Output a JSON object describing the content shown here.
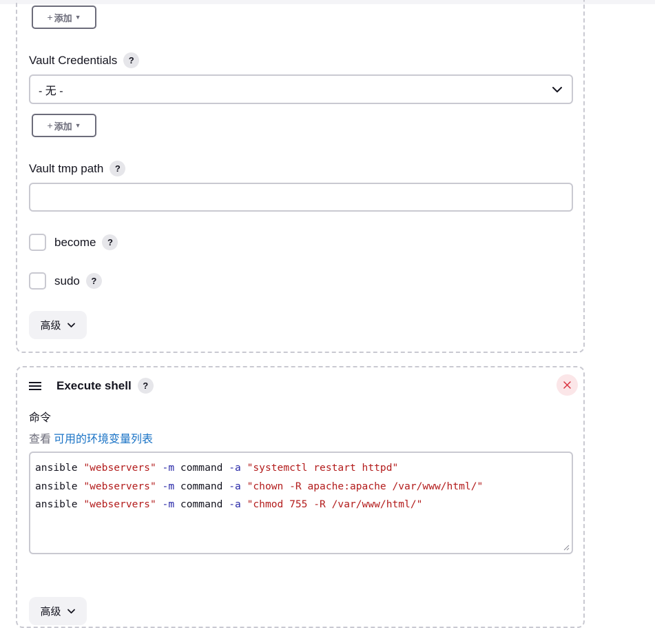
{
  "ansible_section": {
    "add_button_1": {
      "plus": "+",
      "label": "添加"
    },
    "vault_credentials": {
      "label": "Vault Credentials",
      "help": "?",
      "select_value": "- 无 -"
    },
    "add_button_2": {
      "plus": "+",
      "label": "添加"
    },
    "vault_tmp_path": {
      "label": "Vault tmp path",
      "help": "?",
      "value": ""
    },
    "become": {
      "label": "become",
      "help": "?",
      "checked": false
    },
    "sudo": {
      "label": "sudo",
      "help": "?",
      "checked": false
    },
    "advanced_label": "高级"
  },
  "execute_shell": {
    "title": "Execute shell",
    "help": "?",
    "command_label": "命令",
    "env_prefix": "查看",
    "env_link": "可用的环境变量列表",
    "lines": [
      {
        "cmd": "ansible",
        "host": "\"webservers\"",
        "m_flag": "-m",
        "module": "command",
        "a_flag": "-a",
        "arg": "\"systemctl restart httpd\""
      },
      {
        "cmd": "ansible",
        "host": "\"webservers\"",
        "m_flag": "-m",
        "module": "command",
        "a_flag": "-a",
        "arg": "\"chown -R apache:apache /var/www/html/\""
      },
      {
        "cmd": "ansible",
        "host": "\"webservers\"",
        "m_flag": "-m",
        "module": "command",
        "a_flag": "-a",
        "arg": "\"chmod 755 -R /var/www/html/\""
      }
    ],
    "advanced_label": "高级"
  },
  "colors": {
    "link": "#1a73c6",
    "string": "#b31c1c",
    "flag": "#2a2aa8",
    "close": "#d9323f",
    "close_bg": "#fbe6e8"
  },
  "icons": [
    "chevron-down-icon",
    "drag-handle-icon",
    "help-icon",
    "close-icon",
    "resize-grip-icon",
    "caret-down-icon"
  ]
}
